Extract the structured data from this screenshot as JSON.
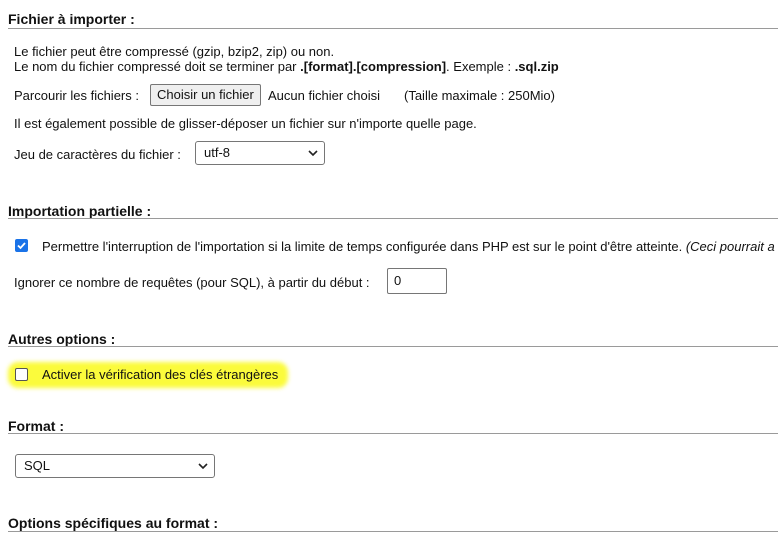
{
  "file_import": {
    "title": "Fichier à importer :",
    "info_line1": "Le fichier peut être compressé (gzip, bzip2, zip) ou non.",
    "info_line2_prefix": "Le nom du fichier compressé doit se terminer par ",
    "info_line2_format": ".[format].[compression]",
    "info_line2_middle": ". Exemple : ",
    "info_line2_example": ".sql.zip",
    "browse_label": "Parcourir les fichiers :",
    "choose_button": "Choisir un fichier",
    "no_file": "Aucun fichier choisi",
    "max_size": "(Taille maximale : 250Mio)",
    "drag_drop_note": "Il est également possible de glisser-déposer un fichier sur n'importe quelle page.",
    "charset_label": "Jeu de caractères du fichier :",
    "charset_value": "utf-8"
  },
  "partial_import": {
    "title": "Importation partielle :",
    "allow_interrupt_label": "Permettre l'interruption de l'importation si la limite de temps configurée dans PHP est sur le point d'être atteinte.",
    "allow_interrupt_note": "(Ceci pourrait a",
    "allow_interrupt_checked": true,
    "skip_label": "Ignorer ce nombre de requêtes (pour SQL), à partir du début :",
    "skip_value": "0"
  },
  "other_options": {
    "title": "Autres options :",
    "foreign_keys_label": "Activer la vérification des clés étrangères",
    "foreign_keys_checked": false,
    "highlight_color": "#fbfb3c"
  },
  "format": {
    "title": "Format :",
    "value": "SQL"
  },
  "format_specific": {
    "title": "Options spécifiques au format :"
  },
  "colors": {
    "checkbox_accent": "#1a73e8",
    "rule": "#9a9a9a"
  }
}
